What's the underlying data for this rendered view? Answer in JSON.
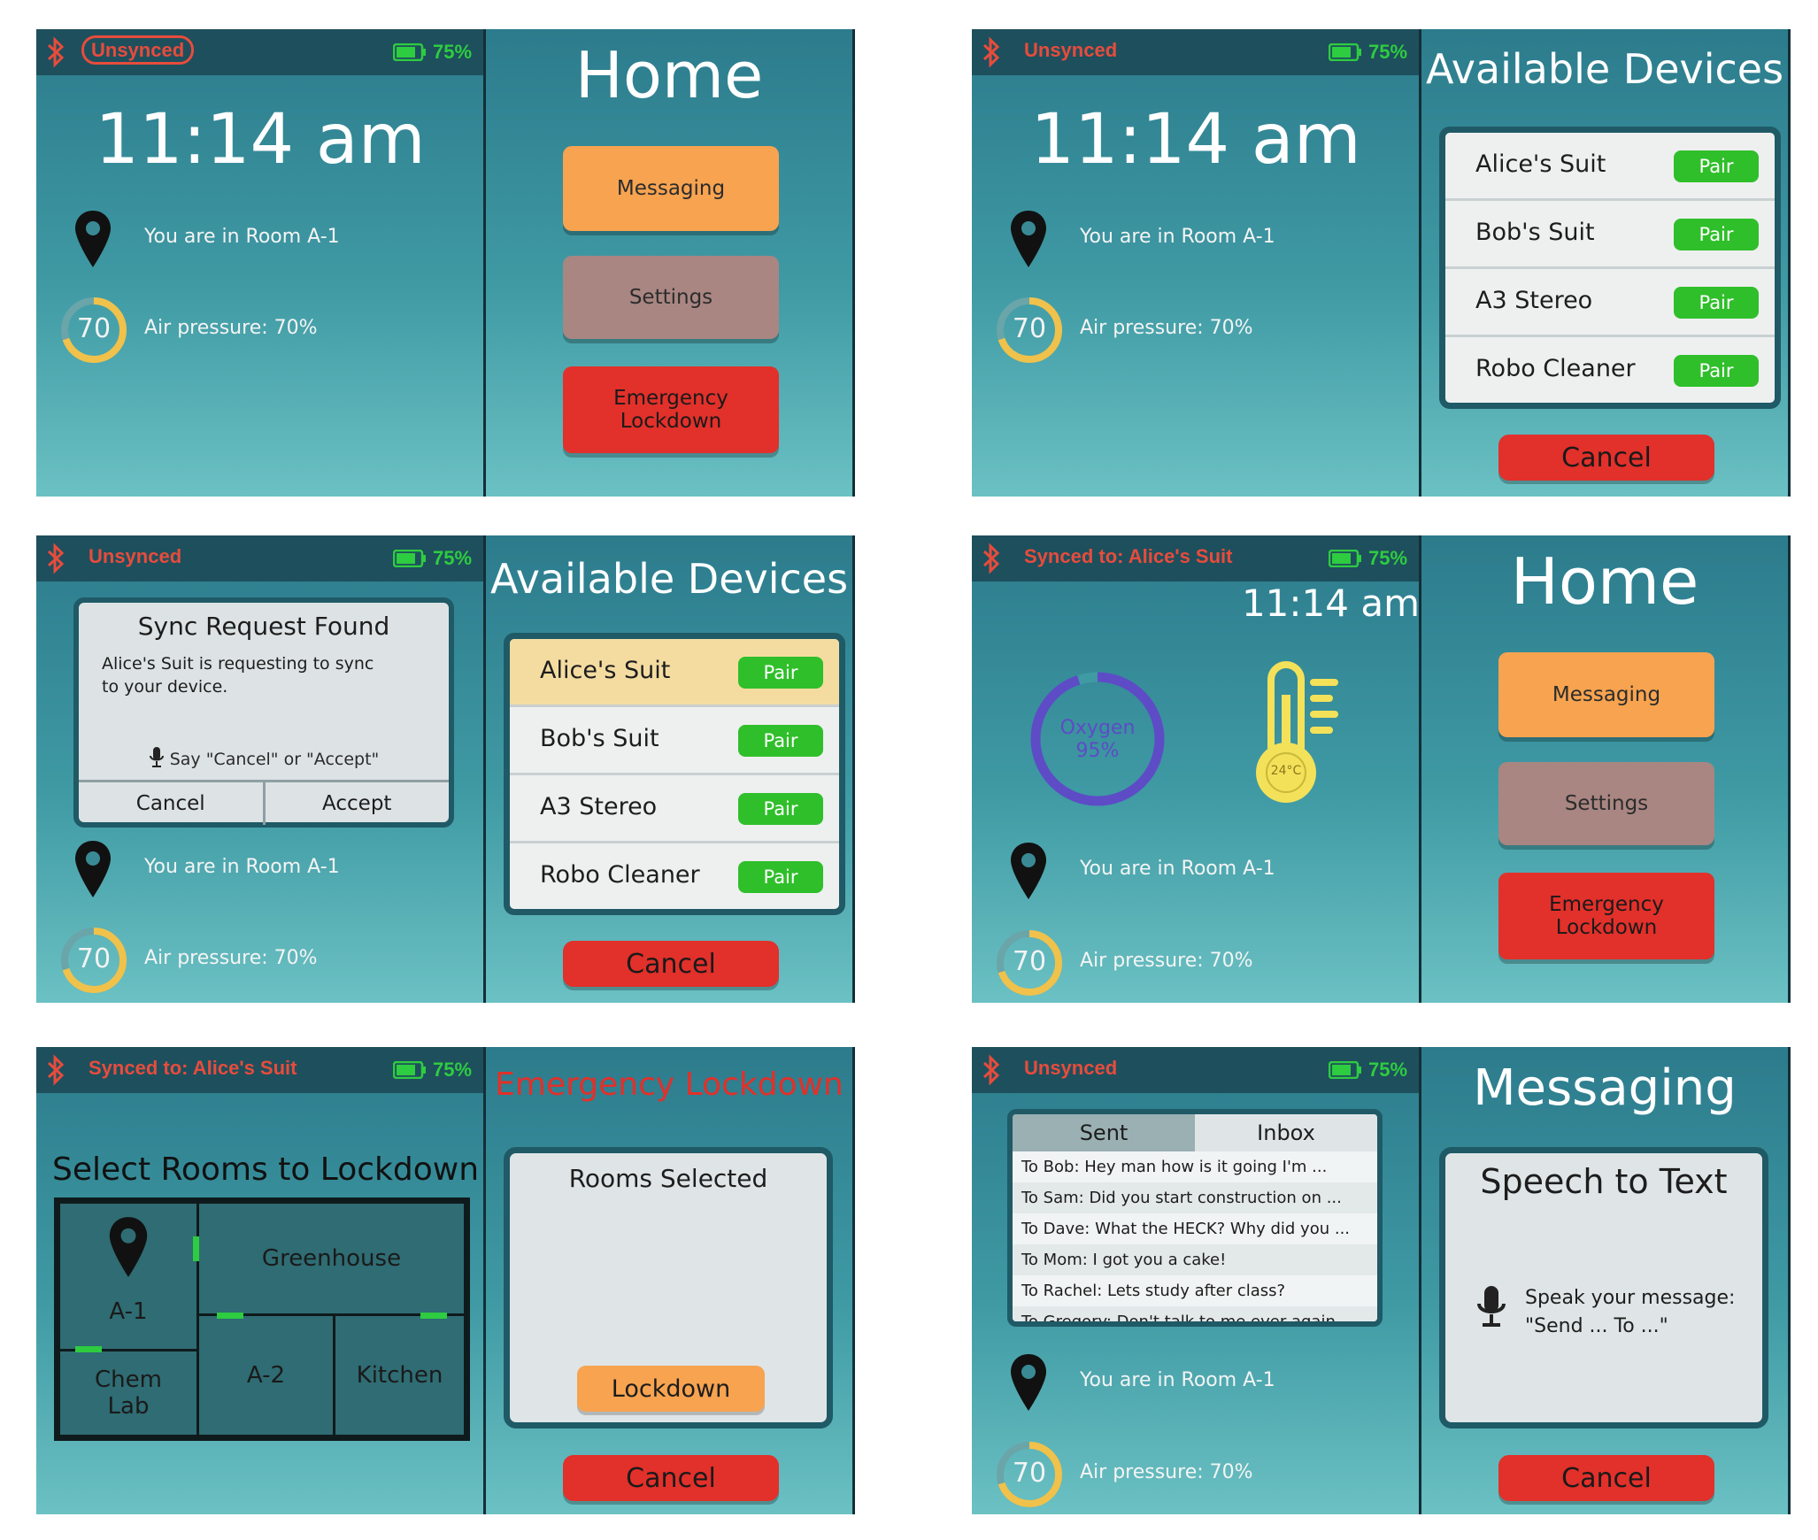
{
  "status": {
    "unsynced": "Unsynced",
    "synced": "Synced to: Alice's Suit",
    "battery": "75%"
  },
  "colors": {
    "accent_green": "#2ecc40",
    "alert_red": "#e74c3c",
    "teal": "#3f9aa4",
    "orange": "#f7a350"
  },
  "clock": "11:14 am",
  "location": "You are in Room A-1",
  "air": {
    "gauge_value": "70",
    "label": "Air pressure: 70%",
    "level_percent": 70
  },
  "home": {
    "title": "Home",
    "buttons": {
      "messaging": "Messaging",
      "settings": "Settings",
      "emergency": "Emergency Lockdown"
    }
  },
  "devices": {
    "title": "Available Devices",
    "items": [
      {
        "name": "Alice's Suit",
        "action": "Pair"
      },
      {
        "name": "Bob's Suit",
        "action": "Pair"
      },
      {
        "name": "A3 Stereo",
        "action": "Pair"
      },
      {
        "name": "Robo Cleaner",
        "action": "Pair"
      }
    ],
    "cancel": "Cancel"
  },
  "sync_dialog": {
    "title": "Sync Request Found",
    "message": "Alice's Suit is requesting to sync to your device.",
    "hint": "Say \"Cancel\" or \"Accept\"",
    "cancel": "Cancel",
    "accept": "Accept"
  },
  "vitals": {
    "oxygen_label": "Oxygen",
    "oxygen_value": "95%",
    "oxygen_level_percent": 95,
    "temperature": "24°C"
  },
  "lockdown": {
    "title": "Emergency Lockdown",
    "map_title": "Select Rooms to Lockdown",
    "rooms": {
      "a1": "A-1",
      "greenhouse": "Greenhouse",
      "chem_lab": "Chem Lab",
      "a2": "A-2",
      "kitchen": "Kitchen"
    },
    "selected_title": "Rooms Selected",
    "lockdown_button": "Lockdown",
    "cancel": "Cancel"
  },
  "messaging": {
    "tabs": {
      "sent": "Sent",
      "inbox": "Inbox"
    },
    "messages": [
      "To Bob: Hey man how is it going I'm ...",
      "To Sam: Did you start construction on ...",
      "To Dave: What the HECK? Why did you ...",
      "To Mom: I got you a cake!",
      "To Rachel: Lets study after class?",
      "To Gregory: Don't talk to me ever again"
    ],
    "title": "Messaging",
    "speech_title": "Speech to Text",
    "speech_hint_line1": "Speak your message:",
    "speech_hint_line2": "\"Send ... To ...\"",
    "cancel": "Cancel"
  }
}
